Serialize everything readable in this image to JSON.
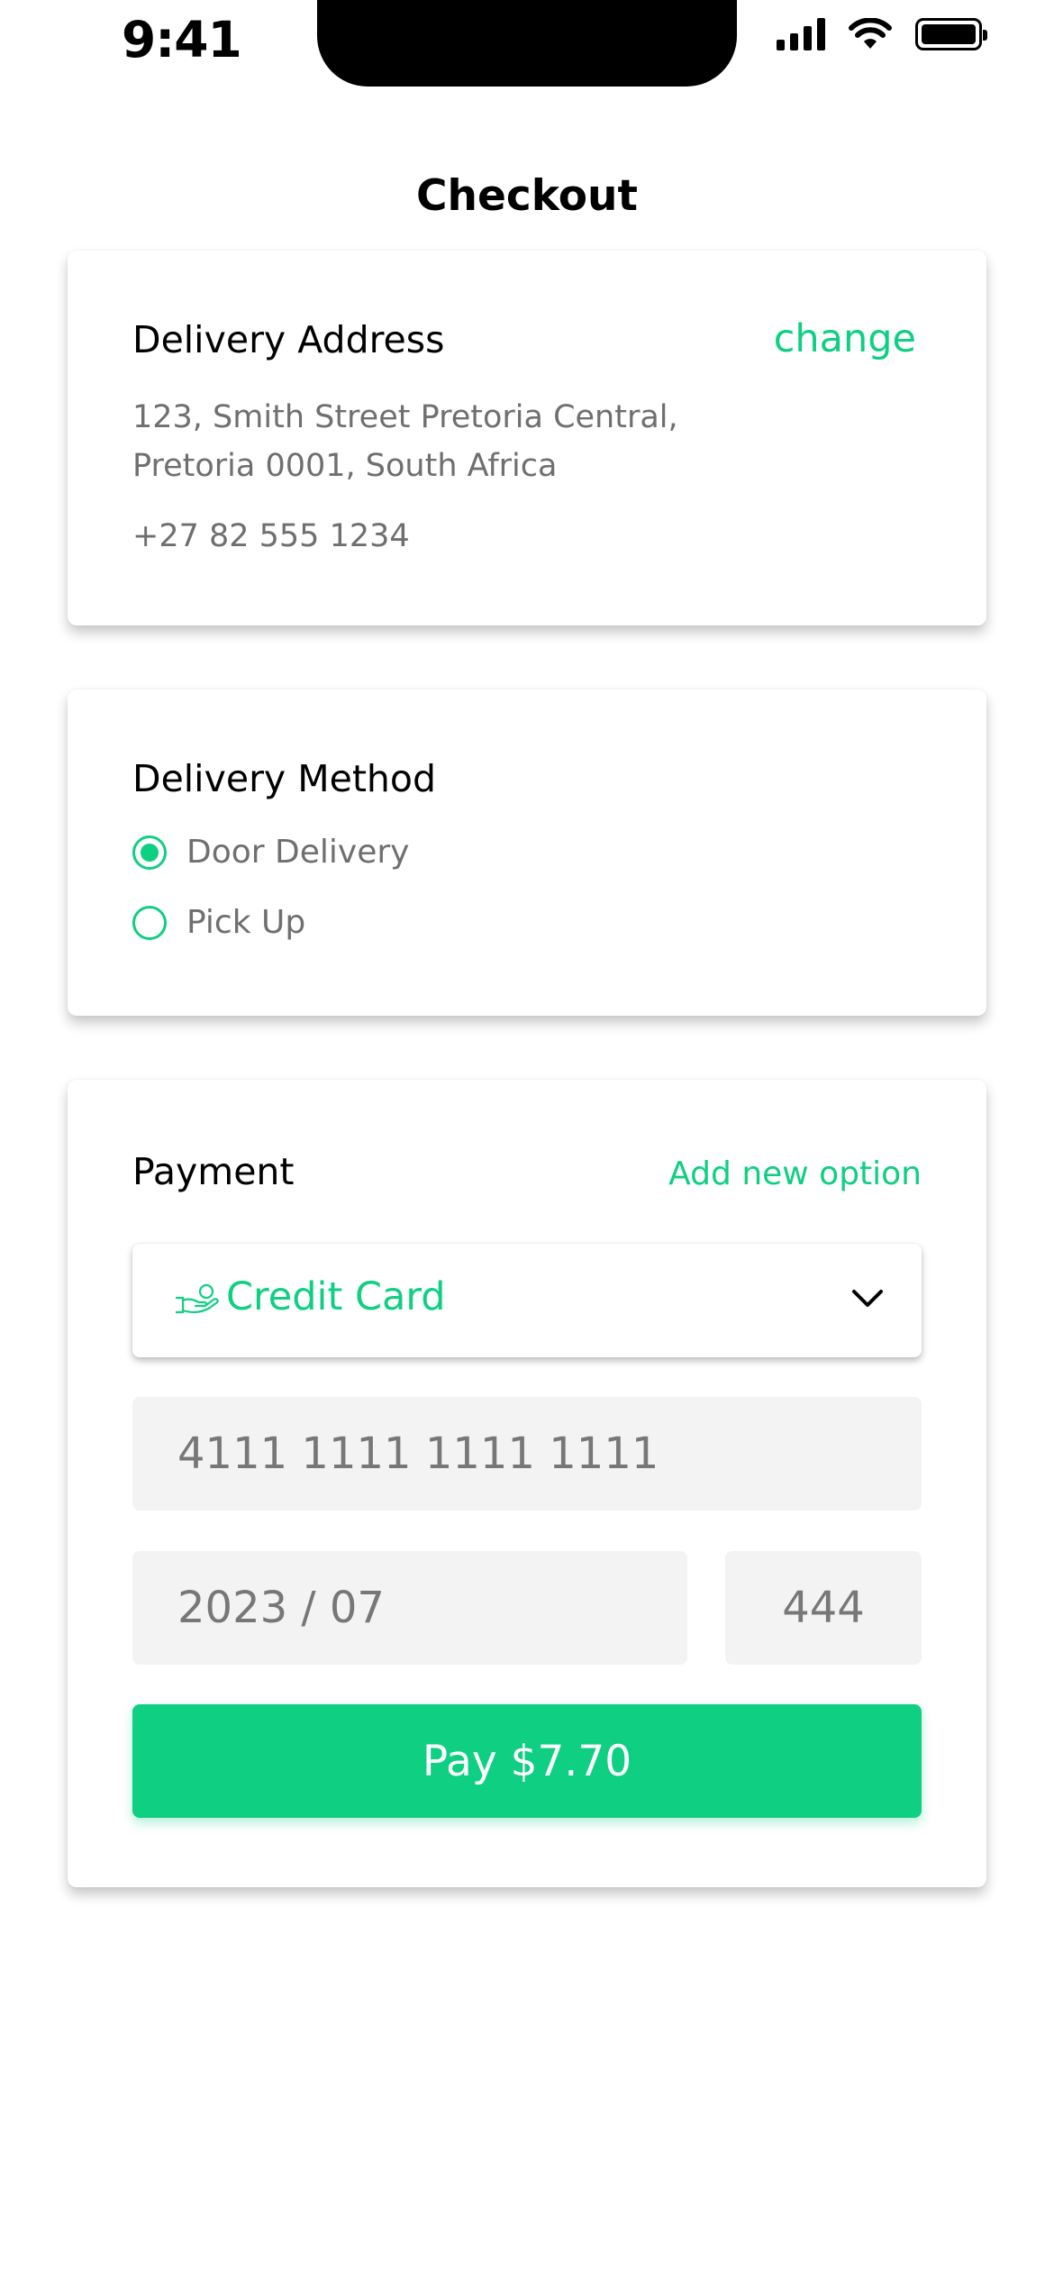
{
  "status_bar": {
    "time": "9:41"
  },
  "page": {
    "title": "Checkout"
  },
  "address": {
    "heading": "Delivery Address",
    "change_label": "change",
    "line1": "123, Smith Street Pretoria Central,",
    "line2": "Pretoria 0001, South Africa",
    "phone": "+27 82 555 1234"
  },
  "delivery": {
    "heading": "Delivery Method",
    "options": [
      {
        "label": "Door Delivery",
        "selected": true
      },
      {
        "label": "Pick Up",
        "selected": false
      }
    ]
  },
  "payment": {
    "heading": "Payment",
    "add_option_label": "Add new option",
    "method_selected": "Credit Card",
    "card_number": "4111 1111 1111 1111",
    "expiry": "2023 / 07",
    "cvv": "444",
    "pay_label": "Pay $7.70"
  },
  "colors": {
    "accent": "#0ecf82",
    "muted_text": "#6f6f6f",
    "field_bg": "#f3f3f3"
  }
}
